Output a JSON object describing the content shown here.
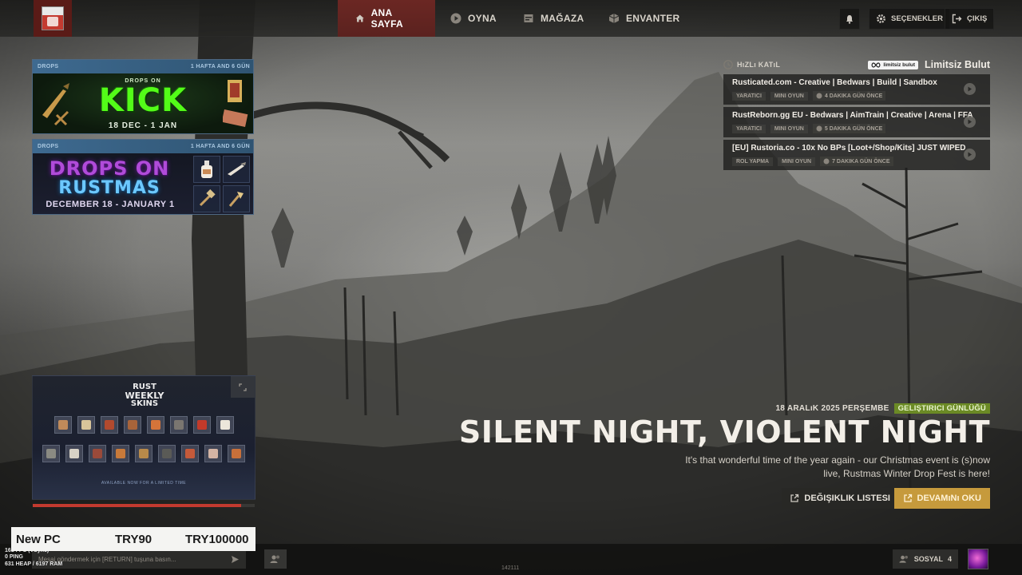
{
  "nav": {
    "items": [
      {
        "label": "ANA SAYFA",
        "icon": "home-icon",
        "active": true
      },
      {
        "label": "OYNA",
        "icon": "play-icon",
        "active": false
      },
      {
        "label": "MAĞAZA",
        "icon": "store-icon",
        "active": false
      },
      {
        "label": "ENVANTER",
        "icon": "inventory-icon",
        "active": false
      }
    ],
    "options_label": "SEÇENEKLER",
    "quit_label": "ÇIKIŞ"
  },
  "drops": [
    {
      "tag": "DROPS",
      "time_left": "1 HAFTA AND 6 GÜN",
      "small": "DROPS ON",
      "title": "KICK",
      "dates": "18 DEC - 1 JAN"
    },
    {
      "tag": "DROPS",
      "time_left": "1 HAFTA AND 6 GÜN",
      "title_line1": "DROPS ON",
      "title_line2": "RUSTMAS",
      "dates": "DECEMBER 18 - JANUARY 1"
    }
  ],
  "quick_join": {
    "title": "HıZLı KATıL",
    "brand_pill": "limitsiz bulut",
    "brand_name": "Limitsiz Bulut",
    "servers": [
      {
        "name": "Rusticated.com - Creative | Bedwars | Build | Sandbox",
        "tag1": "YARATICI",
        "tag2": "MINI OYUN",
        "time": "4 DAKIKA GÜN ÖNCE"
      },
      {
        "name": "RustReborn.gg EU - Bedwars | AimTrain | Creative | Arena | FFA",
        "tag1": "YARATICI",
        "tag2": "MINI OYUN",
        "time": "5 DAKIKA GÜN ÖNCE"
      },
      {
        "name": "[EU] Rustoria.co - 10x No BPs [Loot+/Shop/Kits] JUST WIPED",
        "tag1": "ROL YAPMA",
        "tag2": "MINI OYUN",
        "time": "7 DAKIKA GÜN ÖNCE"
      }
    ]
  },
  "weekly_skins": {
    "title_line1": "RUST",
    "title_line2": "WEEKLY",
    "title_line3": "SKINS",
    "note": "AVAILABLE NOW FOR A LIMITED TIME",
    "progress": 0.94
  },
  "news": {
    "date": "18 ARALıK 2025 PERŞEMBE",
    "badge": "GELIŞTIRICI GÜNLÜĞÜ",
    "badge_color": "#6b8a25",
    "title": "SILENT NIGHT, VIOLENT NIGHT",
    "description": "It's that wonderful time of the year again - our Christmas event is (s)now live, Rustmas Winter Drop Fest is here!",
    "changelog_label": "DEĞIŞIKLIK LISTESI",
    "readmore_label": "DEVAMıNı OKU",
    "accent_color": "#c69a3c"
  },
  "perf_bar": {
    "name": "New PC",
    "price_a": "TRY90",
    "price_b": "TRY100000"
  },
  "stats": {
    "line1": "161 FPS (VSync)",
    "line2": "0 PING",
    "line3": "631 HEAP / 6197 RAM"
  },
  "chat": {
    "placeholder": "Mesaj göndermek için [RETURN] tuşuna basın..."
  },
  "version": "142111",
  "social": {
    "label": "SOSYAL",
    "count": "4"
  }
}
